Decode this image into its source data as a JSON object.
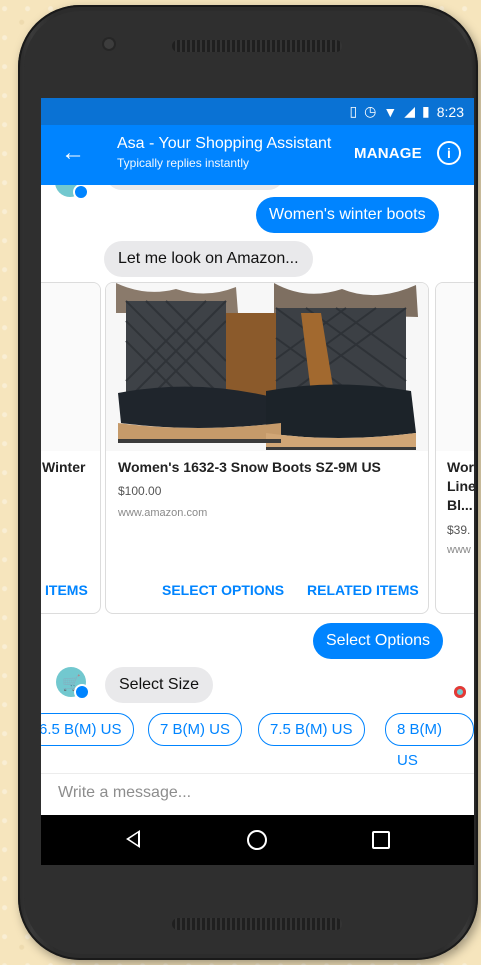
{
  "status_bar": {
    "time": "8:23"
  },
  "header": {
    "title": "Asa - Your Shopping Assistant",
    "subtitle": "Typically replies instantly",
    "manage_label": "MANAGE",
    "info_label": "i"
  },
  "messages": {
    "user_query": "Women's winter boots",
    "bot_reply": "Let me look on Amazon...",
    "user_select": "Select Options",
    "bot_prompt": "Select Size"
  },
  "carousel": {
    "left_card": {
      "name": "Winter",
      "button": "ITEMS"
    },
    "main_card": {
      "name": "Women's 1632-3 Snow Boots SZ-9M US",
      "price": "$100.00",
      "site": "www.amazon.com",
      "button_1": "SELECT OPTIONS",
      "button_2": "RELATED ITEMS"
    },
    "right_card": {
      "name_line1": "Wor",
      "name_line2": "Line",
      "name_line3": "Bl...",
      "price": "$39.",
      "site": "www"
    }
  },
  "quick_replies": [
    "6.5 B(M) US",
    "7 B(M) US",
    "7.5 B(M) US",
    "8 B(M) US"
  ],
  "composer": {
    "placeholder": "Write a message..."
  },
  "colors": {
    "messenger_blue": "#0084ff",
    "status_blue": "#0a72d4",
    "bubble_gray": "#e9e9eb"
  }
}
